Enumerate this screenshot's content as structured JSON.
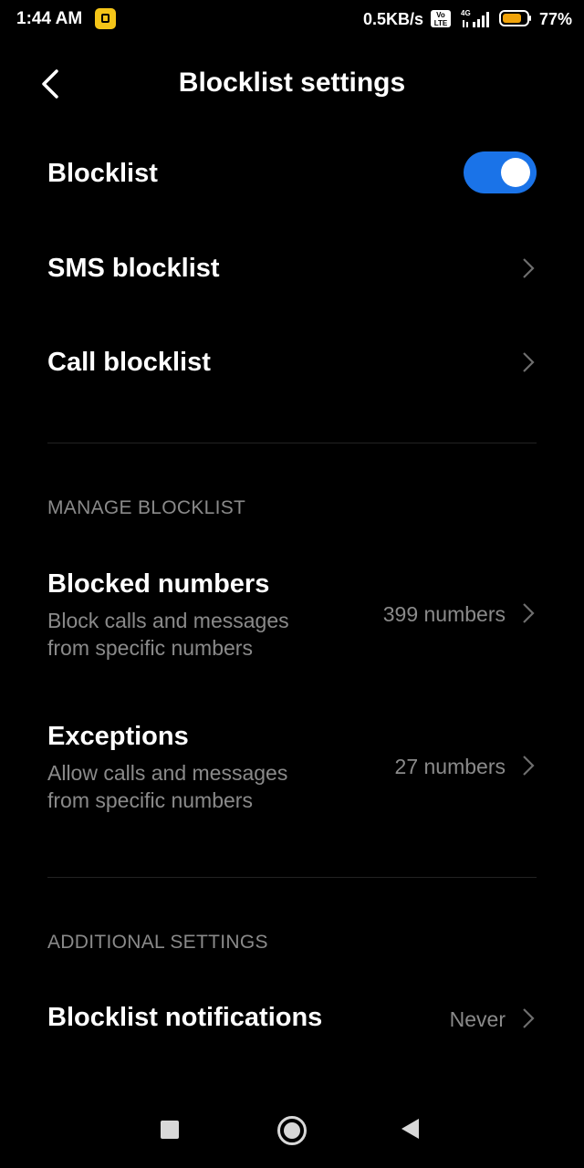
{
  "status_bar": {
    "time": "1:44 AM",
    "net_speed": "0.5KB/s",
    "volte_top": "Vo",
    "volte_bottom": "LTE",
    "network_type": "4G",
    "battery_percent": "77%",
    "battery_level": 0.77,
    "battery_color": "#f0a30a"
  },
  "header": {
    "title": "Blocklist settings",
    "back_icon": "chevron-left-icon"
  },
  "settings": {
    "blocklist": {
      "label": "Blocklist",
      "enabled": true,
      "toggle_color": "#1a73e8"
    },
    "sms_blocklist": {
      "label": "SMS blocklist"
    },
    "call_blocklist": {
      "label": "Call blocklist"
    }
  },
  "manage_section": {
    "header": "MANAGE BLOCKLIST",
    "blocked_numbers": {
      "label": "Blocked numbers",
      "subtitle_line1": "Block calls and messages",
      "subtitle_line2": "from specific numbers",
      "value": "399 numbers"
    },
    "exceptions": {
      "label": "Exceptions",
      "subtitle_line1": "Allow calls and messages",
      "subtitle_line2": "from specific numbers",
      "value": "27 numbers"
    }
  },
  "additional_section": {
    "header": "ADDITIONAL SETTINGS",
    "blocklist_notifications": {
      "label": "Blocklist notifications",
      "value": "Never"
    }
  },
  "nav_bar": {
    "recents_icon": "square-icon",
    "home_icon": "circle-icon",
    "back_icon": "triangle-back-icon"
  }
}
